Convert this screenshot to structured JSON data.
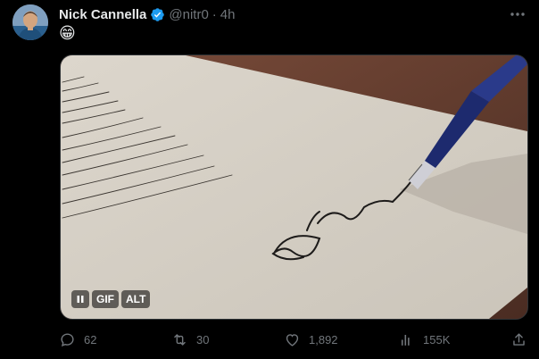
{
  "author": {
    "name": "Nick Cannella",
    "handle": "@nitr0",
    "separator": "·",
    "time": "4h",
    "avatar_icon": "user-avatar",
    "verified_icon": "verified-badge-icon",
    "verified_color": "#1d9bf0"
  },
  "tweet": {
    "text": "😁"
  },
  "media": {
    "type": "gif",
    "pause_icon": "pause-icon",
    "gif_label": "GIF",
    "alt_label": "ALT"
  },
  "actions": {
    "replies": "62",
    "retweets": "30",
    "likes": "1,892",
    "views": "155K",
    "icons": [
      "reply-icon",
      "retweet-icon",
      "like-icon",
      "views-icon",
      "share-icon"
    ]
  },
  "colors": {
    "background": "#000000",
    "primary_text": "#e7e9ea",
    "secondary_text": "#71767b"
  }
}
